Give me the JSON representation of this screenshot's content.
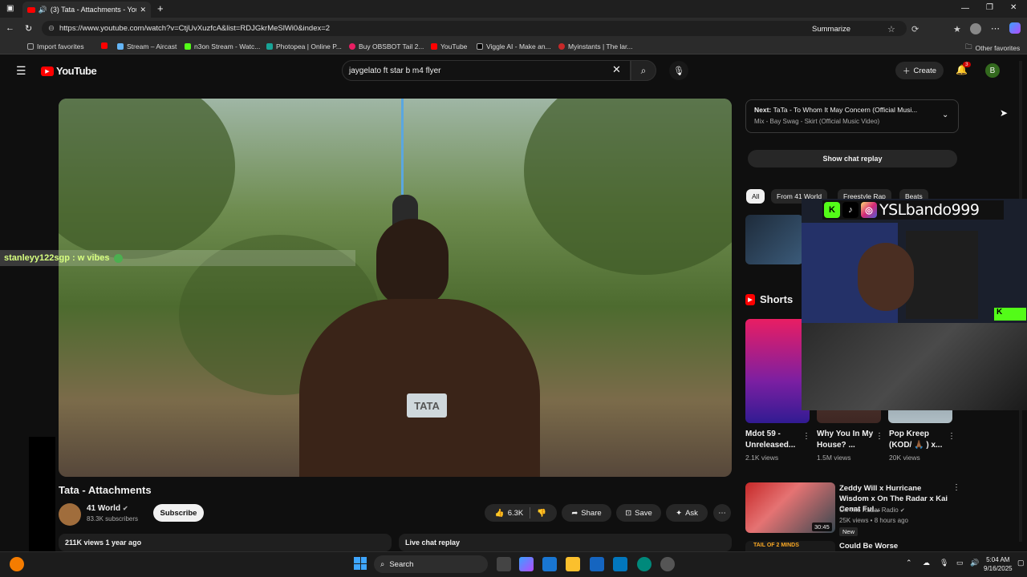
{
  "browser": {
    "tab_title": "(3) Tata - Attachments - You",
    "new_tab": "+",
    "url": "https://www.youtube.com/watch?v=CtjUvXuzfcA&list=RDJGkrMeSlWi0&index=2",
    "summarize": "Summarize",
    "favorites": [
      {
        "label": "Import favorites"
      },
      {
        "label": "Stream – Aircast"
      },
      {
        "label": "n3on Stream - Watc..."
      },
      {
        "label": "Photopea | Online P..."
      },
      {
        "label": "Buy OBSBOT Tail 2..."
      },
      {
        "label": "YouTube"
      },
      {
        "label": "Viggle AI - Make an..."
      },
      {
        "label": "Myinstants | The lar..."
      }
    ],
    "other_favorites": "Other favorites",
    "colors": {
      "chrome": "#2b2b2b",
      "accent": "#ff0000"
    }
  },
  "yt": {
    "logo": "YouTube",
    "search_value": "jaygelato ft star b m4 flyer",
    "create": "Create",
    "notif_count": "3",
    "avatar_letter": "B"
  },
  "video": {
    "chat_overlay": "stanleyy122sgp : w vibes",
    "title": "Tata - Attachments",
    "channel": "41 World",
    "subscribers": "83.3K subscribers",
    "subscribe": "Subscribe",
    "likes": "6.3K",
    "share": "Share",
    "save": "Save",
    "ask": "Ask",
    "more": "⋯",
    "views_age": "211K views  1 year ago",
    "live_chat": "Live chat replay"
  },
  "sidebar": {
    "next_label": "Next:",
    "next_title": "TaTa - To Whom It May Concern (Official Musi...",
    "next_mix": "Mix - Bay Swag - Skirt (Official Music Video)",
    "show_chat": "Show chat replay",
    "chips": [
      "All",
      "From 41 World",
      "Freestyle Rap",
      "Beats"
    ],
    "shorts_heading": "Shorts",
    "shorts": [
      {
        "title": "Mdot 59 - Unreleased...",
        "views": "2.1K views"
      },
      {
        "title": "Why You In My House? ...",
        "views": "1.5M views"
      },
      {
        "title": "Pop Kreep (KOD/ 🙏🏾 ) x...",
        "views": "20K views"
      }
    ],
    "related": [
      {
        "title": "Zeddy Will x Hurricane Wisdom x On The Radar x Kai Cenat Ful...",
        "channel": "On The Radar Radio",
        "meta": "25K views • 8 hours ago",
        "badge": "New",
        "duration": "30:45"
      },
      {
        "title": "Could Be Worse",
        "thumb_text": "TAIL OF 2 MINDS"
      }
    ]
  },
  "overlay": {
    "streamer": "YSLbando999",
    "socials": [
      "K",
      "♪",
      "◎"
    ]
  },
  "taskbar": {
    "search": "Search",
    "time": "5:04 AM",
    "date": "9/16/2025"
  }
}
